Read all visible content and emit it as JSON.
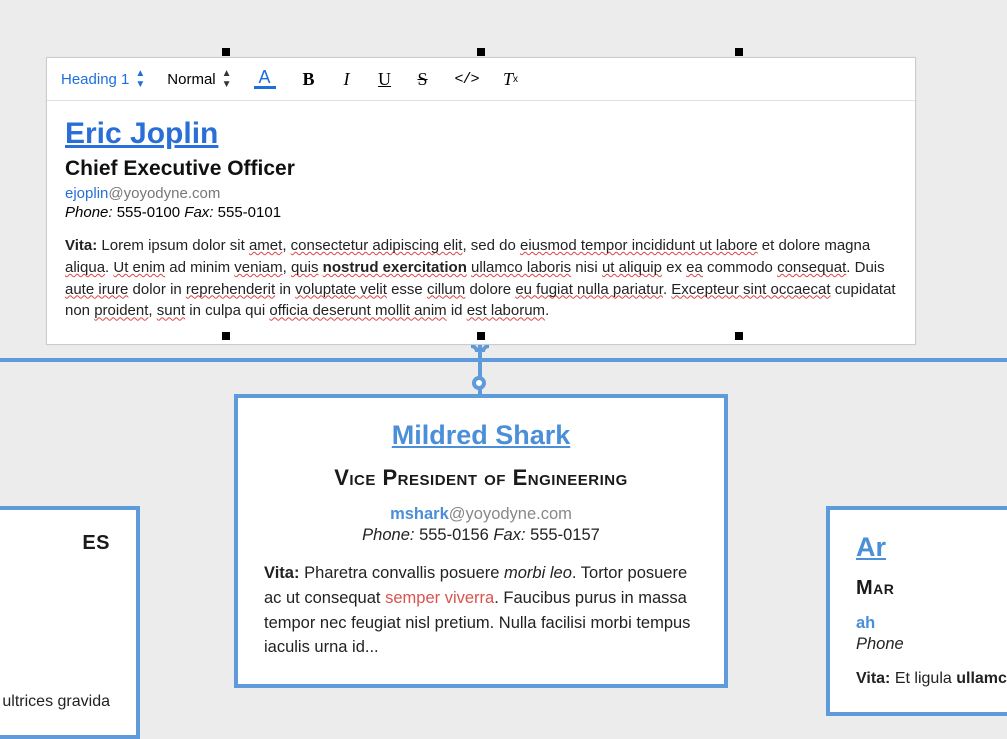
{
  "toolbar": {
    "block_format": "Heading 1",
    "inline_format": "Normal",
    "color_btn": "A",
    "bold": "B",
    "italic": "I",
    "underline": "U",
    "strike": "S",
    "code": "</>",
    "clear": "T",
    "clear_sub": "x"
  },
  "editor": {
    "name": "Eric Joplin",
    "title": "Chief Executive Officer",
    "email_user": "ejoplin",
    "email_domain": "@yoyodyne.com",
    "phone_label": "Phone:",
    "phone": "555-0100",
    "fax_label": "Fax:",
    "fax": "555-0101",
    "vita_label": "Vita:",
    "vita_1": "Lorem ipsum dolor sit ",
    "vita_amet": "amet",
    "vita_2": ", ",
    "vita_cons": "consectetur adipiscing elit",
    "vita_3": ", sed do ",
    "vita_eius": "eiusmod tempor incididunt ut labore",
    "vita_4": " et dolore magna ",
    "vita_aliqua": "aliqua",
    "vita_5": ". ",
    "vita_ut": "Ut enim",
    "vita_6": " ad minim ",
    "vita_veniam": "veniam",
    "vita_7": ", ",
    "vita_quis": "quis",
    "vita_8": " ",
    "vita_nostrud": "nostrud exercitation",
    "vita_9": " ",
    "vita_ullamco": "ullamco laboris",
    "vita_10": " nisi ",
    "vita_utaliquip": "ut aliquip",
    "vita_11": " ex ",
    "vita_ea": "ea",
    "vita_12": " commodo ",
    "vita_consequat": "consequat",
    "vita_13": ". Duis ",
    "vita_aute": "aute irure",
    "vita_14": " dolor in ",
    "vita_repre": "reprehenderit",
    "vita_15": " in ",
    "vita_volup": "voluptate velit",
    "vita_16": " esse ",
    "vita_cillum": "cillum",
    "vita_17": " dolore ",
    "vita_eu": "eu fugiat nulla pariatur",
    "vita_18": ". ",
    "vita_exc": "Excepteur sint occaecat",
    "vita_19": " cupidatat non ",
    "vita_proident": "proident",
    "vita_20": ", ",
    "vita_sunt": "sunt",
    "vita_21": " in culpa qui ",
    "vita_officia": "officia deserunt mollit anim",
    "vita_22": " id ",
    "vita_est": "est laborum",
    "vita_23": "."
  },
  "center_card": {
    "name": "Mildred Shark",
    "title": "Vice President of Engineering",
    "email_user": "mshark",
    "email_domain": "@yoyodyne.com",
    "phone_label": "Phone:",
    "phone": "555-0156",
    "fax_label": "Fax:",
    "fax": "555-0157",
    "vita_label": "Vita:",
    "vita_1": "Pharetra convallis posuere ",
    "vita_it": "morbi leo",
    "vita_2": ". Tortor posuere ac ut consequat ",
    "vita_red": "semper viverra",
    "vita_3": ". Faucibus purus in massa tempor nec feugiat nisl pretium. Nulla facilisi morbi tempus iaculis urna id..."
  },
  "left_card": {
    "title_frag": "ES",
    "vita_frag": "e ultrices gravida"
  },
  "right_card": {
    "name_frag": "Ar",
    "title_frag": "Mar",
    "email_frag": "ah",
    "phone_frag": "Phone",
    "vita_label": "Vita:",
    "vita_frag": "Et ligula ",
    "vita_bold": "ullamcor"
  }
}
